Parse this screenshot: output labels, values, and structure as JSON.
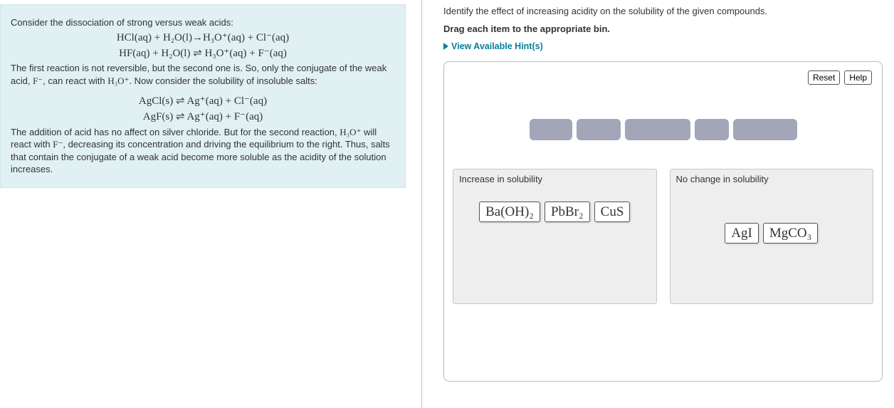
{
  "info": {
    "intro": "Consider the dissociation of strong versus weak acids:",
    "eq1": "HCl(aq) + H₂O(l)→H₃O⁺(aq) + Cl⁻(aq)",
    "eq2": "HF(aq) + H₂O(l) ⇌ H₃O⁺(aq) + F⁻(aq)",
    "para1a": "The first reaction is not reversible, but the second one is. So, only the conjugate of the weak acid, ",
    "f_minus": "F⁻",
    "para1b": ", can react with ",
    "h3o": "H₃O⁺",
    "para1c": ". Now consider the solubility of insoluble salts:",
    "eq3": "AgCl(s) ⇌ Ag⁺(aq) + Cl⁻(aq)",
    "eq4": "AgF(s) ⇌ Ag⁺(aq) + F⁻(aq)",
    "para2a": "The addition of acid has no affect on silver chloride. But for the second reaction, ",
    "para2b": " will react with ",
    "para2c": ", decreasing its concentration and driving the equilibrium to the right. Thus, salts that contain the conjugate of a weak acid become more soluble as the acidity of the solution increases."
  },
  "question": {
    "prompt": "Identify the effect of increasing acidity on the solubility of the given compounds.",
    "instruction": "Drag each item to the appropriate bin.",
    "hints_label": "View Available Hint(s)"
  },
  "buttons": {
    "reset": "Reset",
    "help": "Help"
  },
  "bins": {
    "increase": {
      "label": "Increase in solubility",
      "items": [
        "Ba(OH)₂",
        "PbBr₂",
        "CuS"
      ]
    },
    "nochange": {
      "label": "No change in solubility",
      "items": [
        "AgI",
        "MgCO₃"
      ]
    }
  }
}
